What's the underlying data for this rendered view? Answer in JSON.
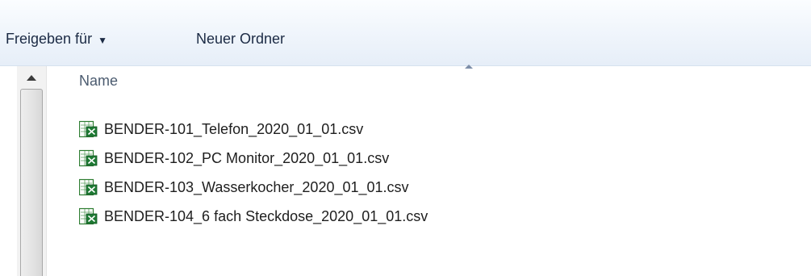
{
  "toolbar": {
    "share_label": "Freigeben für",
    "new_folder_label": "Neuer Ordner"
  },
  "file_list": {
    "column_name": "Name",
    "sort_direction": "ascending",
    "files": [
      {
        "name": "BENDER-101_Telefon_2020_01_01.csv",
        "icon": "excel-csv-icon"
      },
      {
        "name": "BENDER-102_PC Monitor_2020_01_01.csv",
        "icon": "excel-csv-icon"
      },
      {
        "name": "BENDER-103_Wasserkocher_2020_01_01.csv",
        "icon": "excel-csv-icon"
      },
      {
        "name": "BENDER-104_6 fach Steckdose_2020_01_01.csv",
        "icon": "excel-csv-icon"
      }
    ]
  },
  "colors": {
    "toolbar_text": "#1b2a44",
    "header_text": "#4b5b6f",
    "excel_green": "#2e7d32"
  }
}
